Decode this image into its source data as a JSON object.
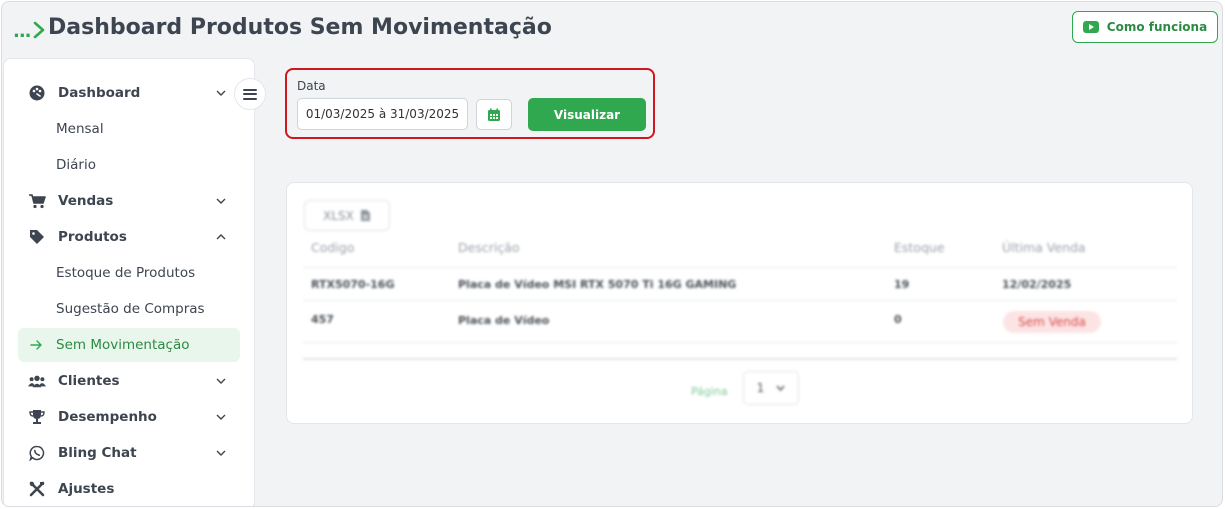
{
  "header": {
    "breadcrumb_dots": "...",
    "title": "Dashboard Produtos Sem Movimentação",
    "help_button": "Como funciona",
    "help_icon": "youtube-play-icon"
  },
  "sidebar": {
    "items": [
      {
        "label": "Dashboard",
        "icon": "palette-icon",
        "chevron": "down"
      },
      {
        "label": "Mensal"
      },
      {
        "label": "Diário"
      },
      {
        "label": "Vendas",
        "icon": "cart-icon",
        "chevron": "down"
      },
      {
        "label": "Produtos",
        "icon": "tag-icon",
        "chevron": "up"
      },
      {
        "label": "Estoque de Produtos"
      },
      {
        "label": "Sugestão de Compras"
      },
      {
        "label": "Sem Movimentação",
        "active": true
      },
      {
        "label": "Clientes",
        "icon": "users-icon",
        "chevron": "down"
      },
      {
        "label": "Desempenho",
        "icon": "trophy-icon",
        "chevron": "down"
      },
      {
        "label": "Bling Chat",
        "icon": "whatsapp-icon",
        "chevron": "down"
      },
      {
        "label": "Ajustes",
        "icon": "tools-icon"
      }
    ]
  },
  "filter": {
    "label": "Data",
    "date_value": "01/03/2025 à 31/03/2025",
    "view_button": "Visualizar"
  },
  "table": {
    "export_label": "XLSX",
    "columns": [
      "Codigo",
      "Descrição",
      "Estoque",
      "Última Venda"
    ],
    "rows": [
      {
        "codigo": "RTX5070-16G",
        "descricao": "Placa de Vídeo MSI RTX 5070 Ti 16G GAMING",
        "estoque": "19",
        "ultima_venda": "12/02/2025"
      },
      {
        "codigo": "457",
        "descricao": "Placa de Vídeo",
        "estoque": "0",
        "ultima_venda": "Sem Venda"
      }
    ],
    "pager_label": "Página",
    "page_value": "1"
  },
  "colors": {
    "accent": "#2fa84f",
    "highlight_border": "#d0161f",
    "badge_bg": "#fde4e4",
    "badge_text": "#d94b4b"
  }
}
